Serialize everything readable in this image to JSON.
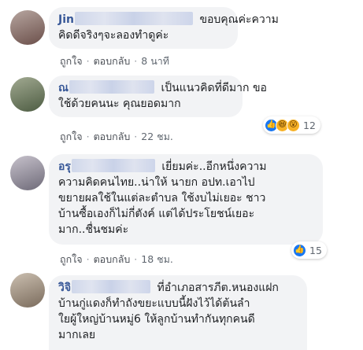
{
  "comments": [
    {
      "name": "Jin",
      "lines": [
        "ขอบคุณค่ะความ",
        "คิดดีจริงๆจะลองทำดูค่ะ"
      ],
      "like_label": "ถูกใจ",
      "reply_label": "ตอบกลับ",
      "time": "8 นาที",
      "avatar_colors": [
        "#6b4f4a",
        "#b7a6a0"
      ]
    },
    {
      "name": "ณ",
      "lines": [
        "เป็นแนวคิดที่ดีมาก ขอ",
        "ใช้ด้วยคนนะ คุณยอดมาก"
      ],
      "like_label": "ถูกใจ",
      "reply_label": "ตอบกลับ",
      "time": "22 ชม.",
      "reaction_count": "12",
      "reaction_icons": [
        "like-icon",
        "haha-icon",
        "wow-icon"
      ],
      "avatar_colors": [
        "#4d5c42",
        "#a2aa92"
      ]
    },
    {
      "name": "อรุ",
      "lines": [
        "เยี่ยมค่ะ..อีกหนึ่งความ",
        "ความคิดคนไทย..น่าให้ นายก อปท.เอาไป",
        "ขยายผลใช้ในแต่ละตำบล ใช้งบไม่เยอะ ชาว",
        "บ้านซื้อเองก็ไม่กี่ตังค์ แต่ได้ประโยชน์เยอะ",
        "มาก..ชื่นชมค่ะ"
      ],
      "like_label": "ถูกใจ",
      "reply_label": "ตอบกลับ",
      "time": "18 ชม.",
      "reaction_count": "15",
      "reaction_icons": [
        "like-icon"
      ],
      "avatar_colors": [
        "#6e6a78",
        "#c7c2cc"
      ]
    },
    {
      "name": "วิจิ",
      "lines": [
        "ที่อำเภอสารภีต.หนองแฝก",
        "บ้านกู่แดงก็ทำถังขยะแบบนี้ฝังไว้ได้ต้นลำ",
        "ใยผู้ใหญ่บ้านหมู่6 ให้ลูกบ้านทำกันทุกคนดี",
        "มากเลย"
      ],
      "avatar_colors": [
        "#7a6b5c",
        "#cbbfb0"
      ]
    }
  ],
  "colors": {
    "name": "#385898",
    "bubble": "#f2f3f5",
    "like_blue": "#1877f2"
  }
}
